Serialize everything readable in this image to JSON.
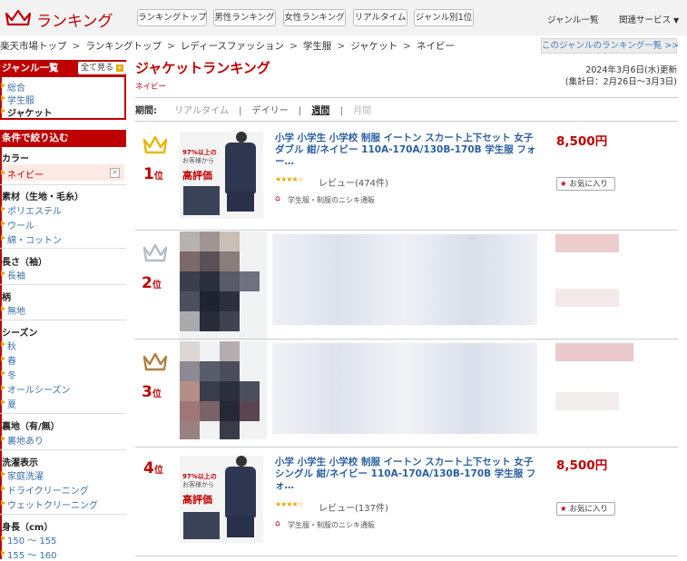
{
  "header": {
    "logo": "ランキング",
    "nav_buttons": [
      "ランキングトップ",
      "男性ランキング",
      "女性ランキング",
      "リアルタイム",
      "ジャンル別1位"
    ],
    "links": [
      "ジャンル一覧",
      "関連サービス"
    ]
  },
  "breadcrumb": [
    "楽天市場トップ",
    "ランキングトップ",
    "レディースファッション",
    "学生服",
    "ジャケット",
    "ネイビー"
  ],
  "list_link": "このジャンルのランキング一覧 >>",
  "sidebar": {
    "genre_head": "ジャンル一覧",
    "show_all": "全て見る",
    "genre_items": [
      "総合",
      "学生服",
      "ジャケット"
    ],
    "filter_head": "条件で絞り込む",
    "color_head": "カラー",
    "color_selected": "ネイビー",
    "sections": [
      {
        "head": "素材（生地・毛糸）",
        "items": [
          "ポリエステル",
          "ウール",
          "綿・コットン"
        ]
      },
      {
        "head": "長さ（袖）",
        "items": [
          "長袖"
        ]
      },
      {
        "head": "柄",
        "items": [
          "無地"
        ]
      },
      {
        "head": "シーズン",
        "items": [
          "秋",
          "春",
          "冬",
          "オールシーズン",
          "夏"
        ]
      },
      {
        "head": "裏地（有/無）",
        "items": [
          "裏地あり"
        ]
      },
      {
        "head": "洗濯表示",
        "items": [
          "家庭洗濯",
          "ドライクリーニング",
          "ウェットクリーニング"
        ]
      },
      {
        "head": "身長（cm）",
        "items": [
          "150 ～ 155",
          "155 ～ 160"
        ]
      }
    ]
  },
  "main": {
    "title": "ジャケットランキング",
    "subtitle": "ネイビー",
    "date": "2024年3月6日(水)更新",
    "period": "(集計日：2月26日～3月3日)",
    "period_label": "期間:",
    "periods": [
      "リアルタイム",
      "デイリー",
      "週間",
      "月間"
    ]
  },
  "items": [
    {
      "rank": "1",
      "rank_suffix": "位",
      "title": "小学 小学生 小学校 制服 イートン スカート上下セット 女子 ダブル 紺/ネイビー 110A-170A/130B-170B 学生服 フォー…",
      "price": "8,500円",
      "review": "レビュー(474件)",
      "shop": "学生服・制服のニシキ通販",
      "fav": "お気に入り",
      "thumb_text": [
        "97%以上の",
        "お客様から",
        "高評価"
      ]
    },
    {
      "rank": "2",
      "rank_suffix": "位"
    },
    {
      "rank": "3",
      "rank_suffix": "位"
    },
    {
      "rank": "4",
      "rank_suffix": "位",
      "title": "小学 小学生 小学校 制服 イートン スカート上下セット 女子 シングル 紺/ネイビー 110A-170A/130B-170B 学生服 フォ…",
      "price": "8,500円",
      "review": "レビュー(137件)",
      "shop": "学生服・制服のニシキ通販",
      "fav": "お気に入り",
      "thumb_text": [
        "97%以上の",
        "お客様から",
        "高評価"
      ]
    }
  ],
  "colors": {
    "brand": "#bf0000",
    "link": "#2a5fa0",
    "gold": "#e6a800"
  }
}
